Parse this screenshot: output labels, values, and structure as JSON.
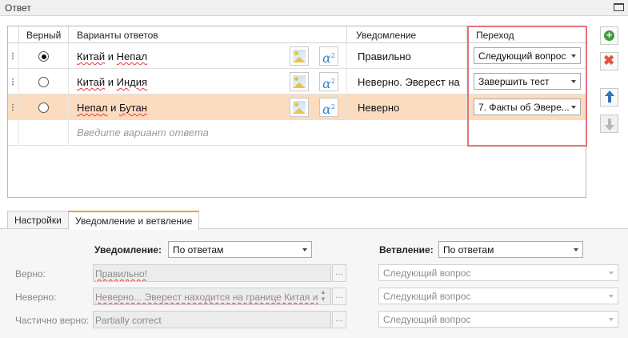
{
  "window": {
    "title": "Ответ"
  },
  "grid": {
    "columns": {
      "correct": "Верный",
      "answers": "Варианты ответов",
      "notification": "Уведомление",
      "transition": "Переход"
    },
    "rows": [
      {
        "answer_a": "Китай",
        "conj": " и ",
        "answer_b": "Непал",
        "notification": "Правильно",
        "transition": "Следующий вопрос",
        "correct": true
      },
      {
        "answer_a": "Китай",
        "conj": " и ",
        "answer_b": "Индия",
        "notification": "Неверно. Эверест на",
        "transition": "Завершить тест",
        "correct": false
      },
      {
        "answer_a": "Непал",
        "conj": " и ",
        "answer_b": "Бутан",
        "notification": "Неверно",
        "transition": "7. Факты об Эвере...",
        "correct": false
      }
    ],
    "new_row_placeholder": "Введите вариант ответа",
    "formula_symbol": "α",
    "formula_sup": "2"
  },
  "side_buttons": {
    "add_glyph": "+",
    "delete_glyph": "✖"
  },
  "tabs": [
    {
      "label": "Настройки",
      "active": false
    },
    {
      "label": "Уведомление и ветвление",
      "active": true
    }
  ],
  "panel": {
    "notification_label": "Уведомление:",
    "notification_mode": "По ответам",
    "branching_label": "Ветвление:",
    "branching_mode": "По ответам",
    "correct_label": "Верно:",
    "correct_text": "Правильно!",
    "wrong_label": "Неверно:",
    "wrong_text": "Неверно... Эверест находится на границе Китая и",
    "partial_label": "Частично верно:",
    "partial_text": "Partially correct",
    "correct_branch": "Следующий вопрос",
    "wrong_branch": "Следующий вопрос",
    "partial_branch": "Следующий вопрос",
    "ellipsis": "...",
    "spin_up": "▲",
    "spin_down": "▼"
  }
}
